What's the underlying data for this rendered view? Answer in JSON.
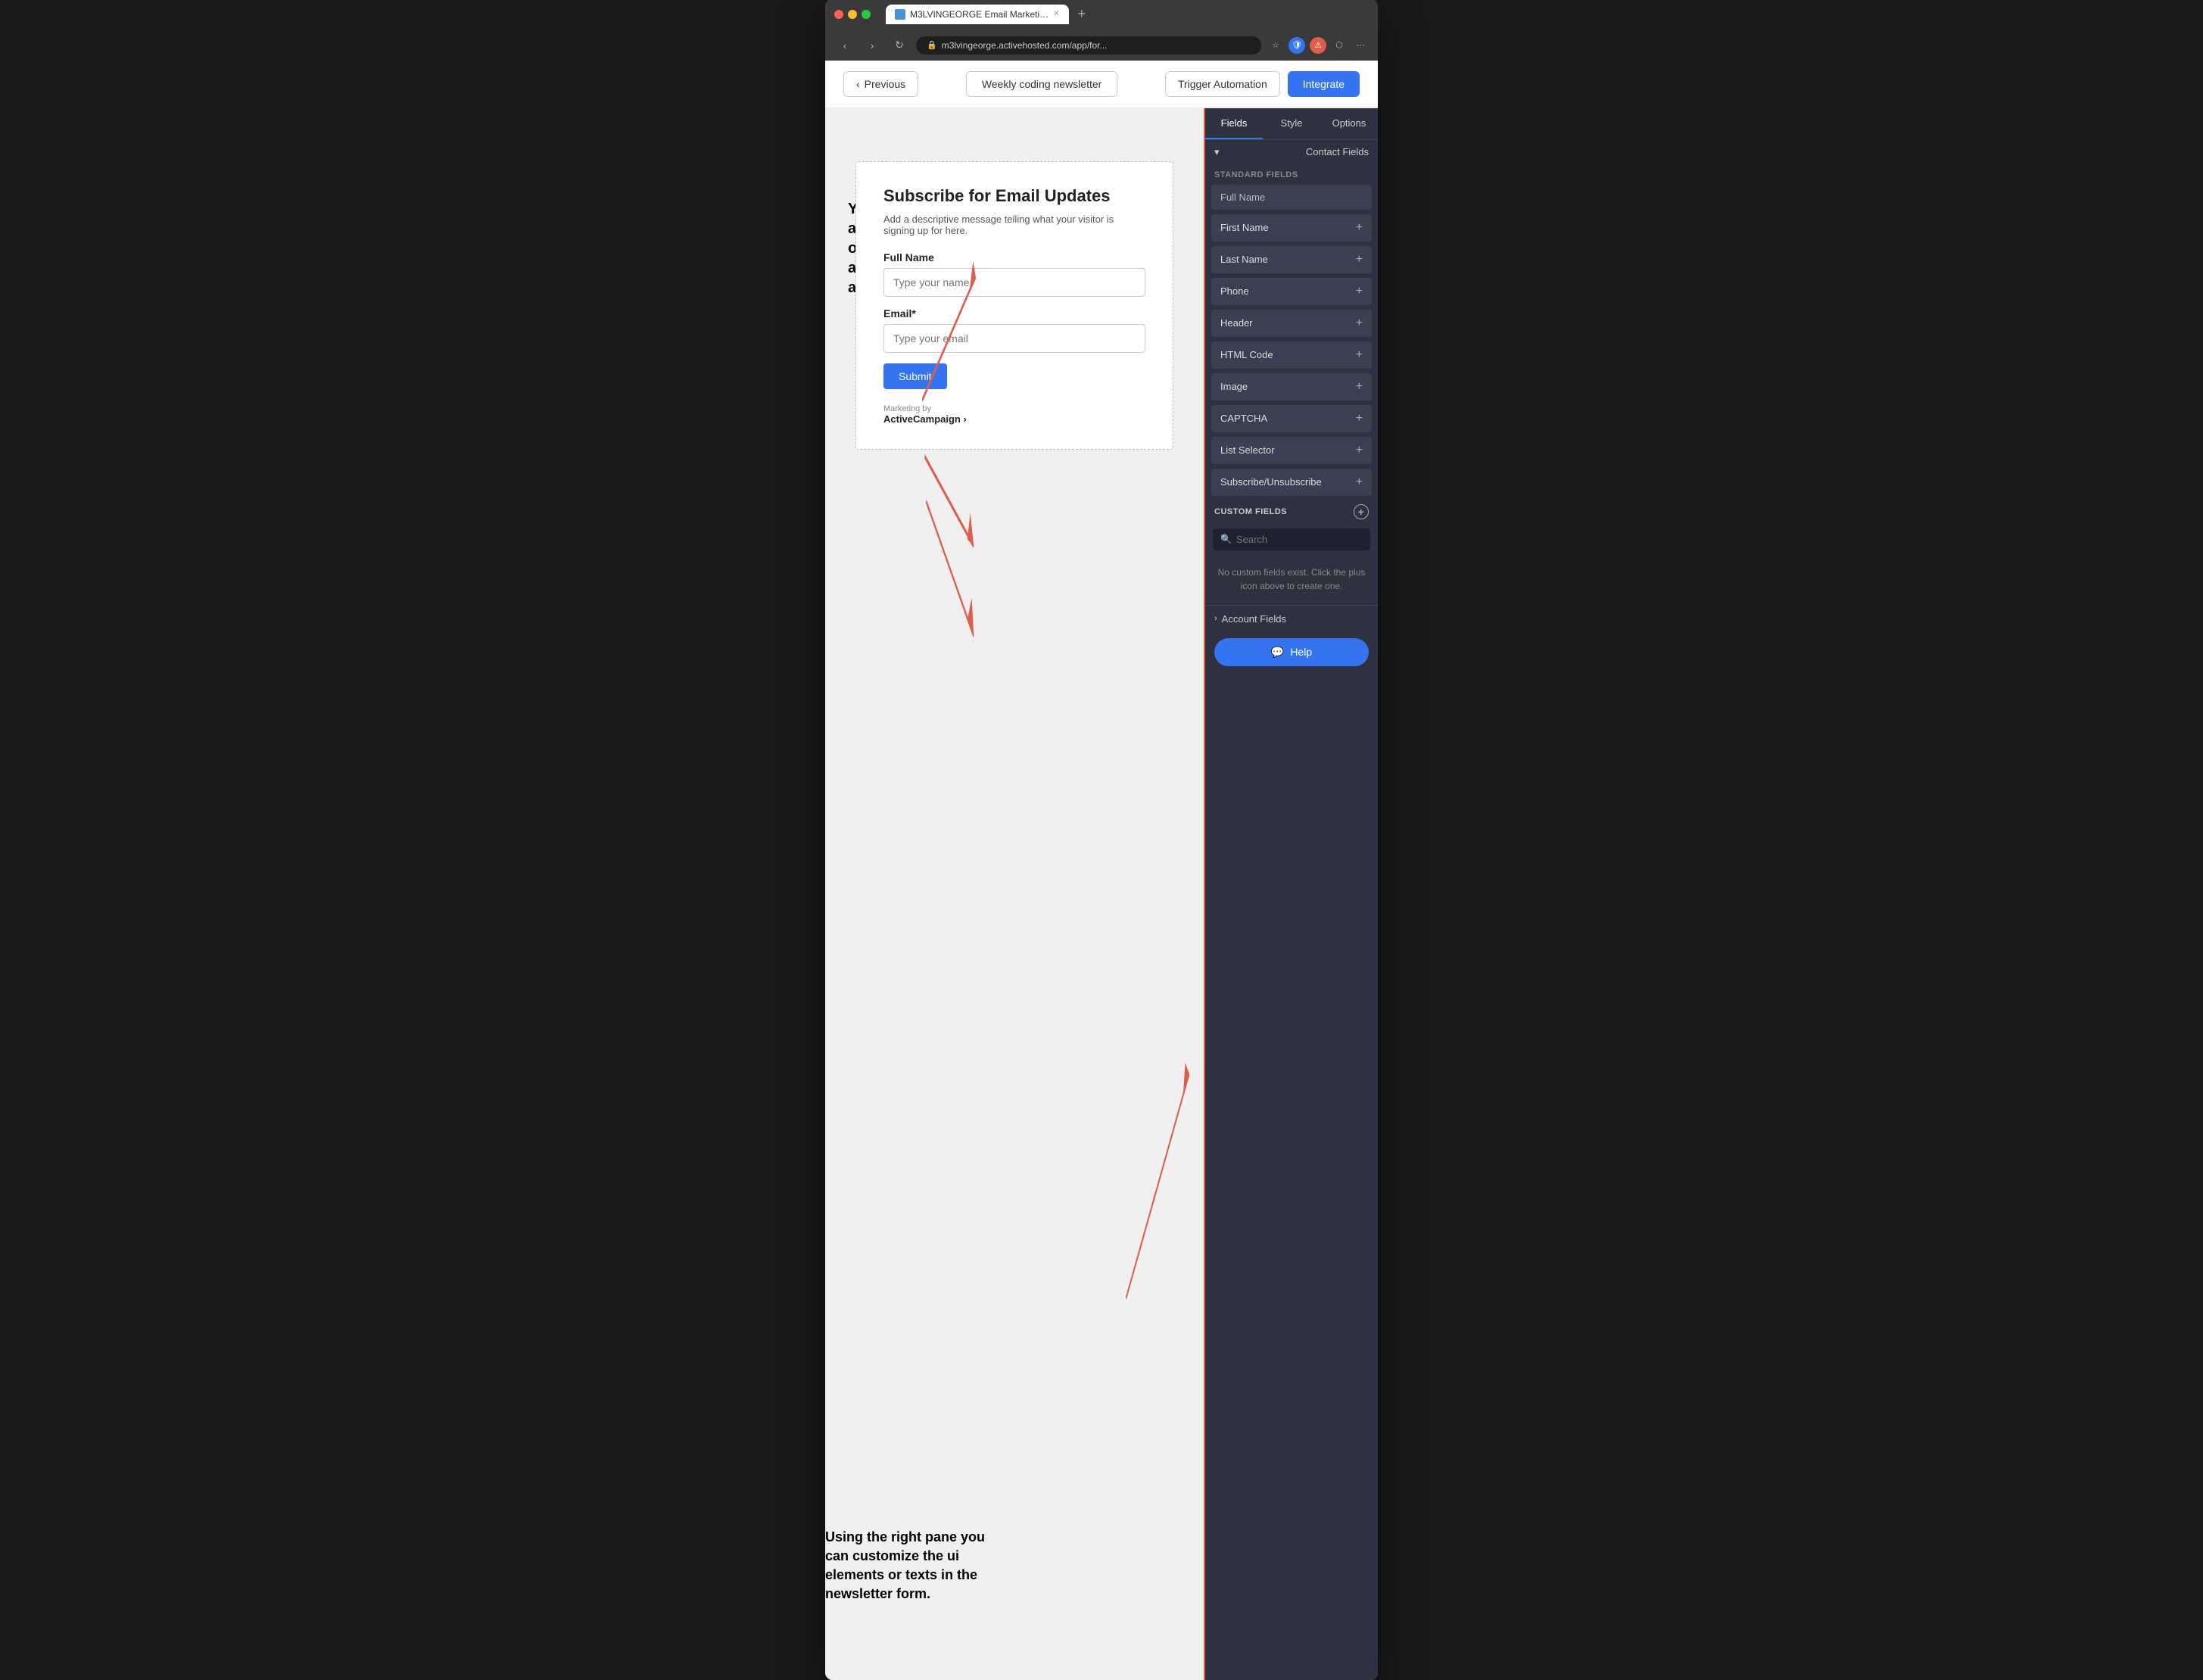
{
  "browser": {
    "tab_title": "M3LVINGEORGE Email Marketi…",
    "url": "m3lvingeorge.activehosted.com/app/for...",
    "new_tab_label": "+",
    "close_label": "✕",
    "back_label": "‹",
    "forward_label": "›",
    "refresh_label": "↻"
  },
  "header": {
    "previous_label": "Previous",
    "newsletter_title": "Weekly coding newsletter",
    "trigger_btn_label": "Trigger Automation",
    "integrate_btn_label": "Integrate"
  },
  "annotations": {
    "left_text": "You can click on any of the texts or ui elements and customize it as you wish.",
    "bottom_right_text": "Using the right pane you can customize the ui elements or texts in the newsletter form."
  },
  "form": {
    "title": "Subscribe for Email Updates",
    "description": "Add a descriptive message telling what your visitor is signing up for here.",
    "full_name_label": "Full Name",
    "full_name_placeholder": "Type your name",
    "email_label": "Email*",
    "email_placeholder": "Type your email",
    "submit_label": "Submit",
    "marketing_by": "Marketing by",
    "activecampaign": "ActiveCampaign ›"
  },
  "right_panel": {
    "tabs": [
      {
        "label": "Fields",
        "active": true
      },
      {
        "label": "Style",
        "active": false
      },
      {
        "label": "Options",
        "active": false
      }
    ],
    "contact_fields_label": "Contact Fields",
    "standard_fields_label": "STANDARD FIELDS",
    "fields": [
      {
        "name": "Full Name",
        "has_plus": false
      },
      {
        "name": "First Name",
        "has_plus": true
      },
      {
        "name": "Last Name",
        "has_plus": true
      },
      {
        "name": "Phone",
        "has_plus": true
      },
      {
        "name": "Header",
        "has_plus": true
      },
      {
        "name": "HTML Code",
        "has_plus": true
      },
      {
        "name": "Image",
        "has_plus": true
      },
      {
        "name": "CAPTCHA",
        "has_plus": true
      },
      {
        "name": "List Selector",
        "has_plus": true
      },
      {
        "name": "Subscribe/Unsubscribe",
        "has_plus": true
      }
    ],
    "custom_fields_label": "CUSTOM FIELDS",
    "search_placeholder": "Search",
    "no_custom_msg": "No custom fields exist. Click the plus icon above to create one.",
    "account_fields_label": "Account Fields",
    "help_label": "Help"
  },
  "colors": {
    "accent_blue": "#3574f0",
    "accent_red": "#e05c4b",
    "panel_bg": "#2e3240",
    "field_bg": "#3a3f52"
  }
}
